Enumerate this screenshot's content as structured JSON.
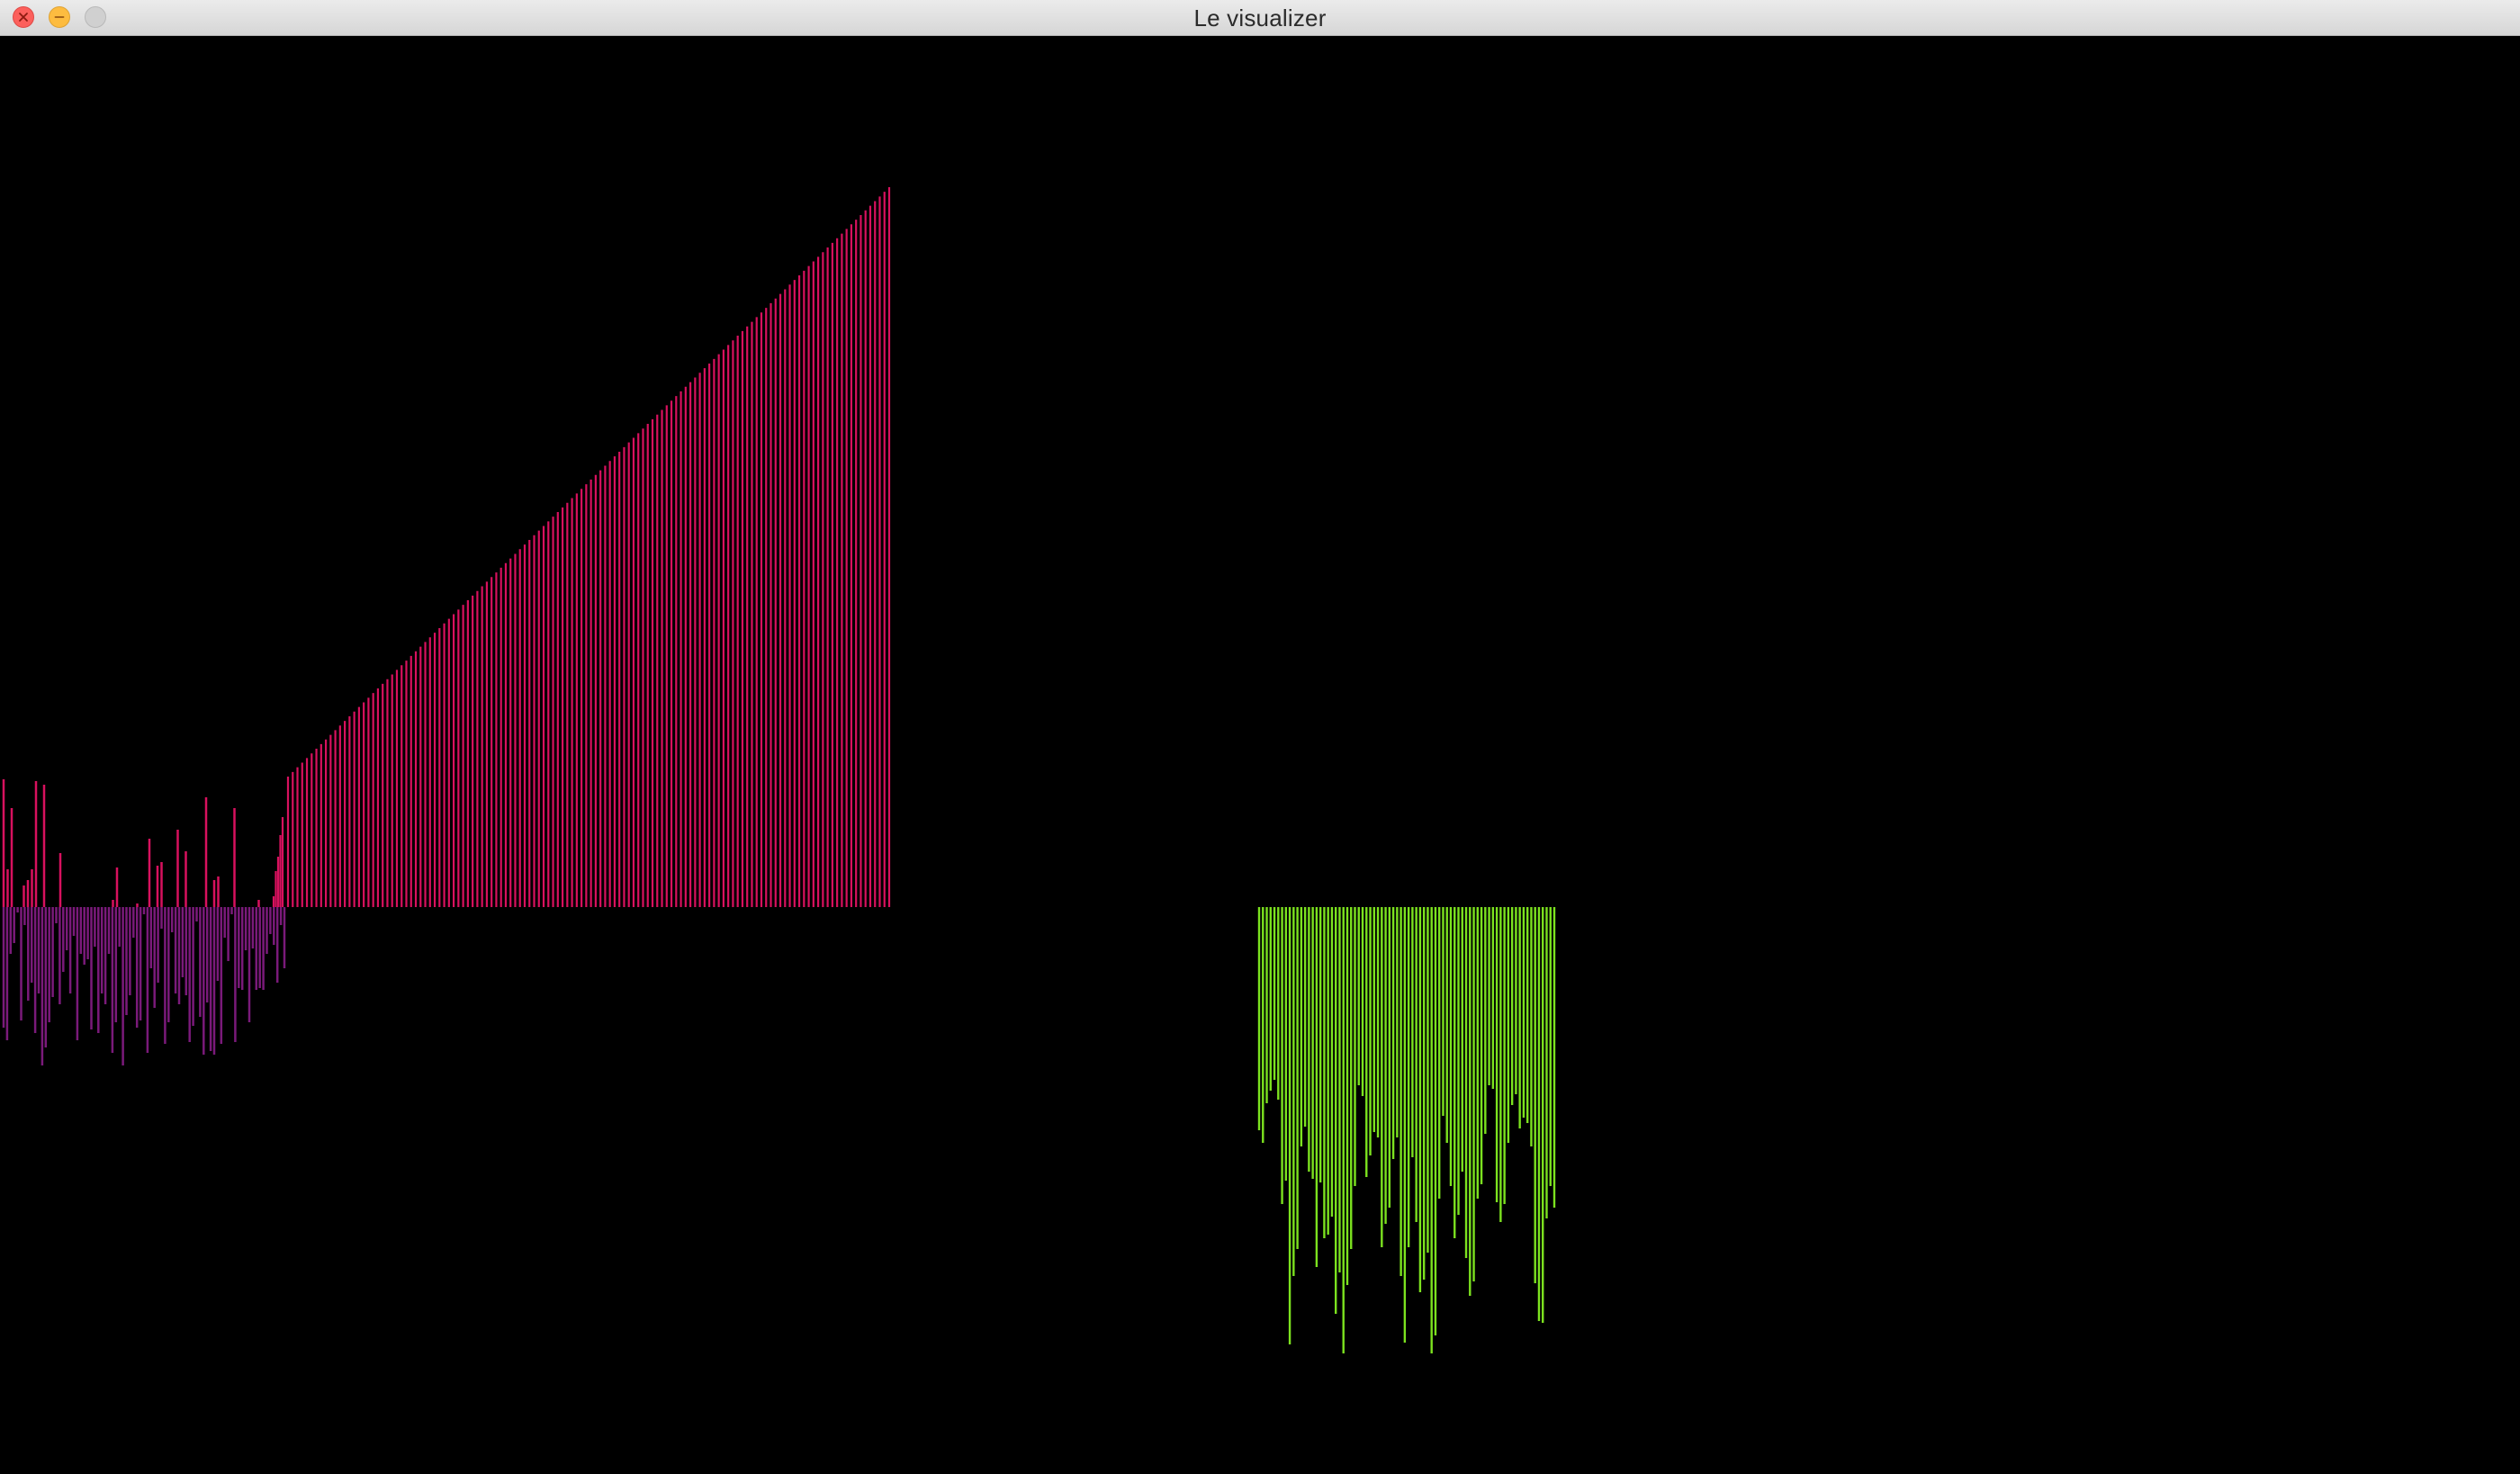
{
  "window": {
    "title": "Le visualizer"
  },
  "colors": {
    "waveform_positive": "#d8115e",
    "waveform_negative": "#7a1a7a",
    "ramp": "#d8115e",
    "spectrum": "#7ce21f",
    "background": "#000000"
  },
  "visualization": {
    "waveform_up": [
      142,
      42,
      110,
      0,
      0,
      24,
      30,
      42,
      140,
      0,
      136,
      0,
      0,
      0,
      60,
      0,
      0,
      0,
      0,
      0,
      0,
      0,
      0,
      0,
      0,
      0,
      0,
      8,
      44,
      0,
      0,
      0,
      0,
      4,
      0,
      0,
      76,
      0,
      46,
      50,
      0,
      0,
      0,
      86,
      0,
      62,
      0,
      0,
      0,
      0,
      122,
      0,
      30,
      34,
      0,
      0,
      0,
      110,
      0,
      0,
      0,
      0,
      0,
      8,
      0,
      0,
      0,
      0,
      0,
      0
    ],
    "waveform_down": [
      134,
      148,
      52,
      40,
      6,
      126,
      20,
      104,
      84,
      140,
      96,
      176,
      156,
      128,
      100,
      18,
      108,
      72,
      48,
      96,
      32,
      148,
      52,
      64,
      58,
      136,
      44,
      140,
      96,
      108,
      52,
      162,
      128,
      44,
      176,
      120,
      98,
      34,
      134,
      126,
      8,
      162,
      68,
      112,
      84,
      24,
      152,
      128,
      28,
      96,
      108,
      78,
      98,
      150,
      132,
      16,
      122,
      164,
      106,
      160,
      164,
      82,
      152,
      34,
      60,
      8,
      150,
      90,
      92,
      48,
      128,
      46,
      92,
      90,
      92,
      52,
      30,
      42,
      84,
      20,
      68
    ],
    "ramp_start": 145,
    "ramp_end": 800,
    "ramp_bar_count": 128,
    "spectrum_levels": [
      248,
      262,
      218,
      204,
      192,
      214,
      330,
      304,
      486,
      410,
      380,
      266,
      244,
      294,
      302,
      400,
      306,
      368,
      364,
      344,
      452,
      406,
      496,
      420,
      380,
      310,
      198,
      210,
      300,
      276,
      250,
      256,
      378,
      352,
      334,
      280,
      256,
      410,
      484,
      378,
      278,
      350,
      428,
      414,
      384,
      496,
      476,
      324,
      232,
      262,
      310,
      368,
      342,
      294,
      390,
      432,
      416,
      324,
      308,
      252,
      198,
      202,
      328,
      350,
      330,
      262,
      220,
      208,
      246,
      234,
      240,
      266,
      418,
      460,
      462,
      346,
      310,
      334
    ]
  }
}
